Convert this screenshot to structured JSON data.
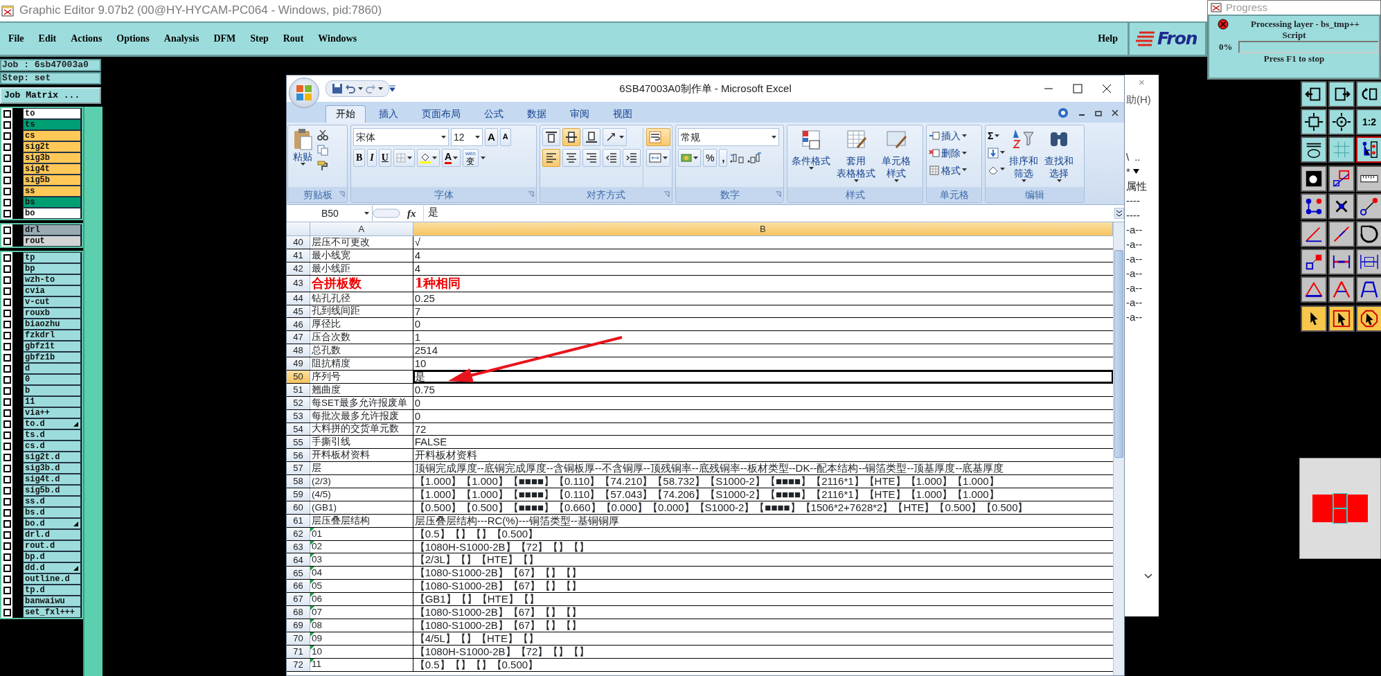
{
  "app": {
    "title": "Graphic Editor 9.07b2 (00@HY-HYCAM-PC064 - Windows, pid:7860)"
  },
  "menu": [
    "File",
    "Edit",
    "Actions",
    "Options",
    "Analysis",
    "DFM",
    "Step",
    "Rout",
    "Windows"
  ],
  "help": "Help",
  "logo": "Fron",
  "job": "Job : 6sb47003a0",
  "step": "Step: set",
  "job_matrix": "Job Matrix ...",
  "layer_groups": [
    [
      {
        "name": "to",
        "color": "#ffffff",
        "checked": false,
        "flagged": false
      },
      {
        "name": "ts",
        "color": "#009e73",
        "checked": false,
        "flagged": false
      },
      {
        "name": "cs",
        "color": "#ffc857",
        "checked": false,
        "flagged": false
      },
      {
        "name": "sig2t",
        "color": "#ffc857",
        "checked": false,
        "flagged": false
      },
      {
        "name": "sig3b",
        "color": "#ffc857",
        "checked": false,
        "flagged": false
      },
      {
        "name": "sig4t",
        "color": "#ffc857",
        "checked": false,
        "flagged": false
      },
      {
        "name": "sig5b",
        "color": "#ffc857",
        "checked": false,
        "flagged": false
      },
      {
        "name": "ss",
        "color": "#ffc857",
        "checked": false,
        "flagged": false
      },
      {
        "name": "bs",
        "color": "#009e73",
        "checked": false,
        "flagged": false
      },
      {
        "name": "bo",
        "color": "#ffffff",
        "checked": false,
        "flagged": false
      }
    ],
    [
      {
        "name": "drl",
        "color": "#9aaab2",
        "checked": false,
        "flagged": false
      },
      {
        "name": "rout",
        "color": "#d3d3d3",
        "checked": false,
        "flagged": false
      }
    ],
    [
      {
        "name": "tp",
        "color": "#9ddcdc",
        "checked": false,
        "flagged": false
      },
      {
        "name": "bp",
        "color": "#9ddcdc",
        "checked": false,
        "flagged": false
      },
      {
        "name": "wzh-to",
        "color": "#9ddcdc",
        "checked": false,
        "flagged": false
      },
      {
        "name": "cvia",
        "color": "#9ddcdc",
        "checked": false,
        "flagged": false
      },
      {
        "name": "v-cut",
        "color": "#9ddcdc",
        "checked": false,
        "flagged": false
      },
      {
        "name": "rouxb",
        "color": "#9ddcdc",
        "checked": false,
        "flagged": false
      },
      {
        "name": "biaozhu",
        "color": "#9ddcdc",
        "checked": false,
        "flagged": false
      },
      {
        "name": "fzkdrl",
        "color": "#9ddcdc",
        "checked": false,
        "flagged": false
      },
      {
        "name": "gbfz1t",
        "color": "#9ddcdc",
        "checked": false,
        "flagged": false
      },
      {
        "name": "gbfz1b",
        "color": "#9ddcdc",
        "checked": false,
        "flagged": false
      },
      {
        "name": "d",
        "color": "#9ddcdc",
        "checked": false,
        "flagged": false
      },
      {
        "name": "0",
        "color": "#9ddcdc",
        "checked": false,
        "flagged": false
      },
      {
        "name": "b",
        "color": "#9ddcdc",
        "checked": false,
        "flagged": false
      },
      {
        "name": "11",
        "color": "#9ddcdc",
        "checked": false,
        "flagged": false
      },
      {
        "name": "via++",
        "color": "#9ddcdc",
        "checked": false,
        "flagged": false
      },
      {
        "name": "to.d",
        "color": "#9ddcdc",
        "checked": false,
        "flagged": true
      },
      {
        "name": "ts.d",
        "color": "#9ddcdc",
        "checked": false,
        "flagged": false
      },
      {
        "name": "cs.d",
        "color": "#9ddcdc",
        "checked": false,
        "flagged": false
      },
      {
        "name": "sig2t.d",
        "color": "#9ddcdc",
        "checked": false,
        "flagged": false
      },
      {
        "name": "sig3b.d",
        "color": "#9ddcdc",
        "checked": false,
        "flagged": false
      },
      {
        "name": "sig4t.d",
        "color": "#9ddcdc",
        "checked": false,
        "flagged": false
      },
      {
        "name": "sig5b.d",
        "color": "#9ddcdc",
        "checked": false,
        "flagged": false
      },
      {
        "name": "ss.d",
        "color": "#9ddcdc",
        "checked": false,
        "flagged": false
      },
      {
        "name": "bs.d",
        "color": "#9ddcdc",
        "checked": false,
        "flagged": false
      },
      {
        "name": "bo.d",
        "color": "#9ddcdc",
        "checked": false,
        "flagged": true
      },
      {
        "name": "drl.d",
        "color": "#9ddcdc",
        "checked": false,
        "flagged": false
      },
      {
        "name": "rout.d",
        "color": "#9ddcdc",
        "checked": false,
        "flagged": false
      },
      {
        "name": "bp.d",
        "color": "#9ddcdc",
        "checked": false,
        "flagged": false
      },
      {
        "name": "dd.d",
        "color": "#9ddcdc",
        "checked": false,
        "flagged": true
      },
      {
        "name": "outline.d",
        "color": "#9ddcdc",
        "checked": false,
        "flagged": false
      },
      {
        "name": "tp.d",
        "color": "#9ddcdc",
        "checked": false,
        "flagged": false
      },
      {
        "name": "banwaiwu",
        "color": "#9ddcdc",
        "checked": false,
        "flagged": false
      },
      {
        "name": "set_fxl+++",
        "color": "#9ddcdc",
        "checked": false,
        "flagged": false
      }
    ]
  ],
  "progress": {
    "title": "Progress",
    "message": "Processing layer - bs_tmp++",
    "sub": "Script",
    "percent": "0%",
    "level": 0,
    "hint": "Press F1 to stop"
  },
  "toolbar": [
    {
      "color": "#9ddcdc",
      "tools": [
        {
          "kind": "pan-left",
          "selected": false
        },
        {
          "kind": "pan-right",
          "selected": false
        },
        {
          "kind": "undo-view",
          "selected": false
        },
        {
          "kind": "fit",
          "selected": false
        },
        {
          "kind": "center",
          "selected": false
        },
        {
          "kind": "ratio",
          "label": "1:2",
          "selected": false
        },
        {
          "kind": "toolbox",
          "selected": false
        },
        {
          "kind": "grid",
          "selected": false
        },
        {
          "kind": "snap",
          "selected": true
        }
      ]
    },
    {
      "color": "#c3c3c3",
      "tools": [
        {
          "kind": "fill-square",
          "selected": false
        },
        {
          "kind": "select-box",
          "selected": false
        },
        {
          "kind": "ruler",
          "selected": false
        },
        {
          "kind": "nodes",
          "selected": false
        },
        {
          "kind": "cross",
          "selected": false
        },
        {
          "kind": "connect",
          "selected": false
        },
        {
          "kind": "angle-line",
          "selected": false
        },
        {
          "kind": "diag-line",
          "selected": false
        },
        {
          "kind": "arc",
          "selected": false
        },
        {
          "kind": "pad",
          "selected": false
        },
        {
          "kind": "dash",
          "selected": false
        },
        {
          "kind": "width",
          "selected": false
        },
        {
          "kind": "triangle-line",
          "selected": false
        },
        {
          "kind": "triangle-a",
          "selected": false
        },
        {
          "kind": "triangle-b",
          "selected": false
        }
      ]
    },
    {
      "color": "#f7c64a",
      "tools": [
        {
          "kind": "pointer",
          "selected": false
        },
        {
          "kind": "pointer-box",
          "selected": false
        },
        {
          "kind": "pointer-octagon",
          "selected": false
        }
      ]
    }
  ],
  "back_panel": {
    "close": "×",
    "menu": "助(H)",
    "tool_a": "\\",
    "tool_b": "..",
    "tool_c": "*",
    "header": "属性",
    "rows": [
      "----",
      "----",
      "-a--",
      "-a--",
      "-a--",
      "-a--",
      "-a--",
      "-a--",
      "-a--"
    ]
  },
  "excel": {
    "title": "6SB47003A0制作单 - Microsoft Excel",
    "tabs": [
      {
        "label": "开始",
        "selected": true
      },
      {
        "label": "插入",
        "selected": false
      },
      {
        "label": "页面布局",
        "selected": false
      },
      {
        "label": "公式",
        "selected": false
      },
      {
        "label": "数据",
        "selected": false
      },
      {
        "label": "审阅",
        "selected": false
      },
      {
        "label": "视图",
        "selected": false
      }
    ],
    "ribbon": [
      {
        "kind": "clipboard",
        "label": "剪贴板",
        "launcher": true,
        "paste": "粘贴"
      },
      {
        "kind": "font",
        "label": "字体",
        "launcher": true,
        "font_name": "宋体",
        "font_size": "12",
        "grow": "A",
        "shrink": "A",
        "bold": "B",
        "italic": "I",
        "underline": "U",
        "font_color": "A",
        "phonetic_ruby": "wén",
        "phonetic": "变"
      },
      {
        "kind": "alignment",
        "label": "对齐方式",
        "launcher": true,
        "buttons": [
          {
            "kind": "top",
            "selected": false
          },
          {
            "kind": "middle",
            "selected": true
          },
          {
            "kind": "bottom",
            "selected": false
          },
          {
            "kind": "orientation",
            "selected": false
          },
          {
            "kind": "wrap",
            "selected": true
          },
          {
            "kind": "left",
            "selected": true
          },
          {
            "kind": "center",
            "selected": false
          },
          {
            "kind": "right",
            "selected": false
          },
          {
            "kind": "outdent",
            "selected": false
          },
          {
            "kind": "indent",
            "selected": false
          },
          {
            "kind": "merge",
            "selected": false
          }
        ]
      },
      {
        "kind": "number",
        "label": "数字",
        "launcher": true,
        "format": "常规",
        "percent": "%",
        "comma": ","
      },
      {
        "kind": "styles",
        "label": "样式",
        "launcher": false,
        "buttons": [
          [
            "条件格式"
          ],
          [
            "套用",
            "表格格式"
          ],
          [
            "单元格",
            "样式"
          ]
        ]
      },
      {
        "kind": "cells",
        "label": "单元格",
        "launcher": false,
        "buttons": [
          "插入",
          "删除",
          "格式"
        ]
      },
      {
        "kind": "editing",
        "label": "编辑",
        "launcher": false,
        "sum": "Σ",
        "buttons": [
          [
            "排序和",
            "筛选"
          ],
          [
            "查找和",
            "选择"
          ]
        ]
      }
    ],
    "name_box": "B50",
    "fx": "fx",
    "formula": "是",
    "columns": [
      {
        "label": "A",
        "selected": false
      },
      {
        "label": "B",
        "selected": true
      }
    ],
    "rows": [
      {
        "number": "40",
        "a": "层压不可更改",
        "b": "√",
        "kind": "normal",
        "selected": false,
        "flag": false
      },
      {
        "number": "41",
        "a": "最小线宽",
        "b": "4",
        "kind": "normal",
        "selected": false,
        "flag": false
      },
      {
        "number": "42",
        "a": "最小线距",
        "b": "4",
        "kind": "normal",
        "selected": false,
        "flag": false
      },
      {
        "number": "43",
        "a": "合拼板数",
        "b": "1种相同",
        "kind": "emphasis",
        "selected": false,
        "flag": false
      },
      {
        "number": "44",
        "a": "钻孔孔径",
        "b": "0.25",
        "kind": "normal",
        "selected": false,
        "flag": false
      },
      {
        "number": "45",
        "a": "孔到线间距",
        "b": "7",
        "kind": "normal",
        "selected": false,
        "flag": false
      },
      {
        "number": "46",
        "a": "厚径比",
        "b": "0",
        "kind": "normal",
        "selected": false,
        "flag": false
      },
      {
        "number": "47",
        "a": "压合次数",
        "b": "1",
        "kind": "normal",
        "selected": false,
        "flag": false
      },
      {
        "number": "48",
        "a": "总孔数",
        "b": "2514",
        "kind": "normal",
        "selected": false,
        "flag": false
      },
      {
        "number": "49",
        "a": "阻抗精度",
        "b": "10",
        "kind": "normal",
        "selected": false,
        "flag": false
      },
      {
        "number": "50",
        "a": "序列号",
        "b": "是",
        "kind": "normal",
        "selected": true,
        "flag": false
      },
      {
        "number": "51",
        "a": "翘曲度",
        "b": "0.75",
        "kind": "normal",
        "selected": false,
        "flag": false
      },
      {
        "number": "52",
        "a": "每SET最多允许报废单",
        "b": "0",
        "kind": "normal",
        "selected": false,
        "flag": false
      },
      {
        "number": "53",
        "a": "每批次最多允许报废",
        "b": "0",
        "kind": "normal",
        "selected": false,
        "flag": false
      },
      {
        "number": "54",
        "a": "大料拼的交货单元数",
        "b": "72",
        "kind": "normal",
        "selected": false,
        "flag": false
      },
      {
        "number": "55",
        "a": "手撕引线",
        "b": "FALSE",
        "kind": "normal",
        "selected": false,
        "flag": false
      },
      {
        "number": "56",
        "a": "开料板材资料",
        "b": "开料板材资料",
        "kind": "normal",
        "selected": false,
        "flag": false
      },
      {
        "number": "57",
        "a": "层",
        "b": "顶铜完成厚度--底铜完成厚度--含铜板厚--不含铜厚--顶残铜率--底残铜率--板材类型--DK--配本结构--铜箔类型--顶基厚度--底基厚度",
        "kind": "normal",
        "selected": false,
        "flag": false
      },
      {
        "number": "58",
        "a": "(2/3)",
        "b": "【1.000】【1.000】【■■■■】【0.110】【74.210】【58.732】【S1000-2】【■■■■】【2116*1】【HTE】【1.000】【1.000】",
        "kind": "normal",
        "selected": false,
        "flag": false
      },
      {
        "number": "59",
        "a": "(4/5)",
        "b": "【1.000】【1.000】【■■■■】【0.110】【57.043】【74.206】【S1000-2】【■■■■】【2116*1】【HTE】【1.000】【1.000】",
        "kind": "normal",
        "selected": false,
        "flag": false
      },
      {
        "number": "60",
        "a": "(GB1)",
        "b": "【0.500】【0.500】【■■■■】【0.660】【0.000】【0.000】【S1000-2】【■■■■】【1506*2+7628*2】【HTE】【0.500】【0.500】",
        "kind": "normal",
        "selected": false,
        "flag": false
      },
      {
        "number": "61",
        "a": "层压叠层结构",
        "b": "层压叠层结构---RC(%)---铜箔类型--基铜铜厚",
        "kind": "normal",
        "selected": false,
        "flag": false
      },
      {
        "number": "62",
        "a": "01",
        "b": "【0.5】【】【】【0.500】",
        "kind": "normal",
        "selected": false,
        "flag": true
      },
      {
        "number": "63",
        "a": "02",
        "b": "【1080H-S1000-2B】【72】【】【】",
        "kind": "normal",
        "selected": false,
        "flag": true
      },
      {
        "number": "64",
        "a": "03",
        "b": "【2/3L】【】【HTE】【】",
        "kind": "normal",
        "selected": false,
        "flag": true
      },
      {
        "number": "65",
        "a": "04",
        "b": "【1080-S1000-2B】【67】【】【】",
        "kind": "normal",
        "selected": false,
        "flag": true
      },
      {
        "number": "66",
        "a": "05",
        "b": "【1080-S1000-2B】【67】【】【】",
        "kind": "normal",
        "selected": false,
        "flag": true
      },
      {
        "number": "67",
        "a": "06",
        "b": "【GB1】【】【HTE】【】",
        "kind": "normal",
        "selected": false,
        "flag": true
      },
      {
        "number": "68",
        "a": "07",
        "b": "【1080-S1000-2B】【67】【】【】",
        "kind": "normal",
        "selected": false,
        "flag": true
      },
      {
        "number": "69",
        "a": "08",
        "b": "【1080-S1000-2B】【67】【】【】",
        "kind": "normal",
        "selected": false,
        "flag": true
      },
      {
        "number": "70",
        "a": "09",
        "b": "【4/5L】【】【HTE】【】",
        "kind": "normal",
        "selected": false,
        "flag": true
      },
      {
        "number": "71",
        "a": "10",
        "b": "【1080H-S1000-2B】【72】【】【】",
        "kind": "normal",
        "selected": false,
        "flag": true
      },
      {
        "number": "72",
        "a": "11",
        "b": "【0.5】【】【】【0.500】",
        "kind": "normal",
        "selected": false,
        "flag": true
      }
    ]
  }
}
